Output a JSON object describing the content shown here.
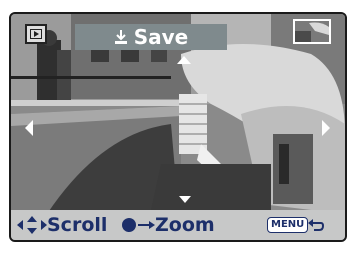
{
  "screen": {
    "mode_icon": "playback-icon",
    "save_icon": "save-download-icon",
    "save_label": "Save",
    "thumbnail_icon": "thumbnail-navigator-icon"
  },
  "nav_arrows": [
    "up-arrow-icon",
    "down-arrow-icon",
    "left-arrow-icon",
    "right-arrow-icon"
  ],
  "bottom_bar": {
    "scroll_icon": "four-way-arrows-icon",
    "scroll_label": "Scroll",
    "zoom_icon": "center-button-icon",
    "zoom_label": "Zoom",
    "menu_key": "MENU",
    "back_icon": "return-arrow-icon"
  },
  "colors": {
    "banner_bg": "#7f8a8d",
    "bar_bg": "#c7c8c8",
    "hint_text": "#1d2f6a"
  }
}
